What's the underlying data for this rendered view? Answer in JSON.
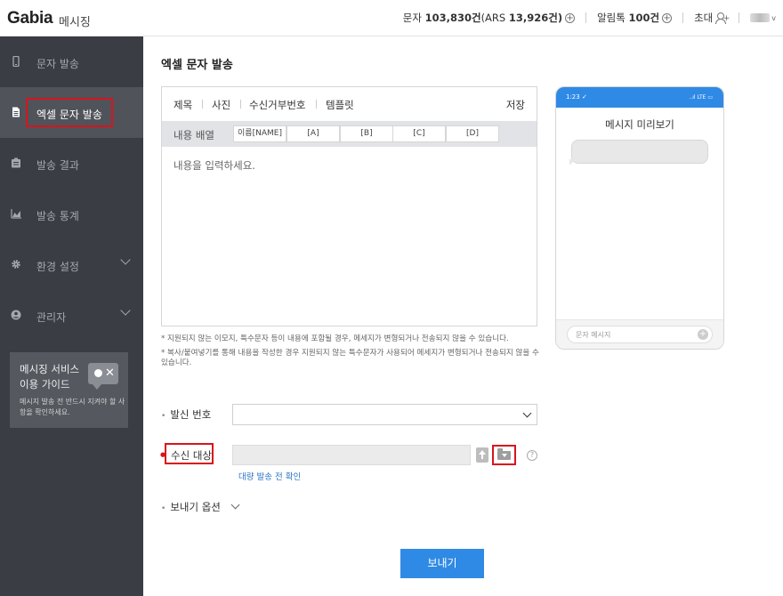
{
  "header": {
    "logo": "Gabia",
    "logo_sub": "메시징",
    "sms_label": "문자",
    "sms_count": "103,830건",
    "ars_label": "(ARS",
    "ars_count": "13,926건)",
    "alimtalk_label": "알림톡",
    "alimtalk_count": "100건",
    "invite_label": "초대"
  },
  "sidebar": {
    "items": [
      {
        "label": "문자 발송",
        "icon": "phone-icon"
      },
      {
        "label": "엑셀 문자 발송",
        "icon": "document-icon"
      },
      {
        "label": "발송 결과",
        "icon": "clipboard-icon"
      },
      {
        "label": "발송 통계",
        "icon": "chart-icon"
      },
      {
        "label": "환경 설정",
        "icon": "gear-icon"
      },
      {
        "label": "관리자",
        "icon": "user-circle-icon"
      }
    ],
    "guide": {
      "title": "메시징 서비스 이용 가이드",
      "desc": "메시지 발송 전 반드시 지켜야 할 사항을 확인하세요."
    }
  },
  "main": {
    "page_title": "엑셀 문자 발송",
    "toolbar": {
      "subject": "제목",
      "photo": "사진",
      "reject_number": "수신거부번호",
      "template": "템플릿",
      "save": "저장"
    },
    "vars": {
      "label": "내용 배열",
      "cells": [
        "이름[NAME]",
        "[A]",
        "[B]",
        "[C]",
        "[D]"
      ]
    },
    "editor_placeholder": "내용을 입력하세요.",
    "notes": [
      "* 지원되지 않는 이모지, 특수문자 등이 내용에 포함될 경우, 메세지가 변형되거나 전송되지 않을 수 있습니다.",
      "* 복사/붙여넣기를 통해 내용을 작성한 경우 지원되지 않는 특수문자가 사용되어 메세지가 변형되거나 전송되지 않을 수 있습니다."
    ],
    "sender_label": "발신 번호",
    "sender_value": "",
    "recipient_label": "수신 대상",
    "recipient_value": "",
    "bulk_check": "대량 발송 전 확인",
    "send_options": "보내기 옵션",
    "send_button": "보내기"
  },
  "preview": {
    "time": "1:23 ✓",
    "signal": "..ıl LTE ▭",
    "title": "메시지 미리보기",
    "input_placeholder": "문자 메시지"
  }
}
